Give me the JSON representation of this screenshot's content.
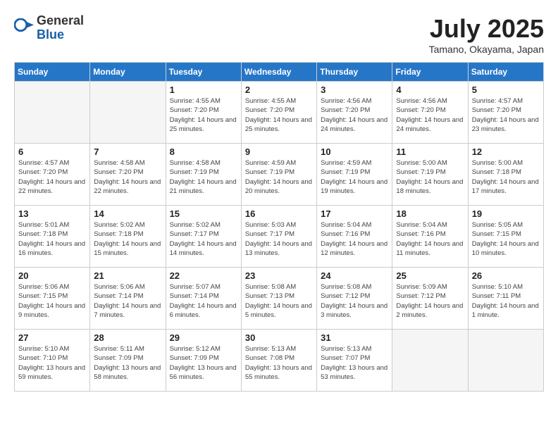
{
  "header": {
    "logo_general": "General",
    "logo_blue": "Blue",
    "month": "July 2025",
    "location": "Tamano, Okayama, Japan"
  },
  "days_of_week": [
    "Sunday",
    "Monday",
    "Tuesday",
    "Wednesday",
    "Thursday",
    "Friday",
    "Saturday"
  ],
  "weeks": [
    [
      {
        "day": "",
        "info": ""
      },
      {
        "day": "",
        "info": ""
      },
      {
        "day": "1",
        "info": "Sunrise: 4:55 AM\nSunset: 7:20 PM\nDaylight: 14 hours and 25 minutes."
      },
      {
        "day": "2",
        "info": "Sunrise: 4:55 AM\nSunset: 7:20 PM\nDaylight: 14 hours and 25 minutes."
      },
      {
        "day": "3",
        "info": "Sunrise: 4:56 AM\nSunset: 7:20 PM\nDaylight: 14 hours and 24 minutes."
      },
      {
        "day": "4",
        "info": "Sunrise: 4:56 AM\nSunset: 7:20 PM\nDaylight: 14 hours and 24 minutes."
      },
      {
        "day": "5",
        "info": "Sunrise: 4:57 AM\nSunset: 7:20 PM\nDaylight: 14 hours and 23 minutes."
      }
    ],
    [
      {
        "day": "6",
        "info": "Sunrise: 4:57 AM\nSunset: 7:20 PM\nDaylight: 14 hours and 22 minutes."
      },
      {
        "day": "7",
        "info": "Sunrise: 4:58 AM\nSunset: 7:20 PM\nDaylight: 14 hours and 22 minutes."
      },
      {
        "day": "8",
        "info": "Sunrise: 4:58 AM\nSunset: 7:19 PM\nDaylight: 14 hours and 21 minutes."
      },
      {
        "day": "9",
        "info": "Sunrise: 4:59 AM\nSunset: 7:19 PM\nDaylight: 14 hours and 20 minutes."
      },
      {
        "day": "10",
        "info": "Sunrise: 4:59 AM\nSunset: 7:19 PM\nDaylight: 14 hours and 19 minutes."
      },
      {
        "day": "11",
        "info": "Sunrise: 5:00 AM\nSunset: 7:19 PM\nDaylight: 14 hours and 18 minutes."
      },
      {
        "day": "12",
        "info": "Sunrise: 5:00 AM\nSunset: 7:18 PM\nDaylight: 14 hours and 17 minutes."
      }
    ],
    [
      {
        "day": "13",
        "info": "Sunrise: 5:01 AM\nSunset: 7:18 PM\nDaylight: 14 hours and 16 minutes."
      },
      {
        "day": "14",
        "info": "Sunrise: 5:02 AM\nSunset: 7:18 PM\nDaylight: 14 hours and 15 minutes."
      },
      {
        "day": "15",
        "info": "Sunrise: 5:02 AM\nSunset: 7:17 PM\nDaylight: 14 hours and 14 minutes."
      },
      {
        "day": "16",
        "info": "Sunrise: 5:03 AM\nSunset: 7:17 PM\nDaylight: 14 hours and 13 minutes."
      },
      {
        "day": "17",
        "info": "Sunrise: 5:04 AM\nSunset: 7:16 PM\nDaylight: 14 hours and 12 minutes."
      },
      {
        "day": "18",
        "info": "Sunrise: 5:04 AM\nSunset: 7:16 PM\nDaylight: 14 hours and 11 minutes."
      },
      {
        "day": "19",
        "info": "Sunrise: 5:05 AM\nSunset: 7:15 PM\nDaylight: 14 hours and 10 minutes."
      }
    ],
    [
      {
        "day": "20",
        "info": "Sunrise: 5:06 AM\nSunset: 7:15 PM\nDaylight: 14 hours and 9 minutes."
      },
      {
        "day": "21",
        "info": "Sunrise: 5:06 AM\nSunset: 7:14 PM\nDaylight: 14 hours and 7 minutes."
      },
      {
        "day": "22",
        "info": "Sunrise: 5:07 AM\nSunset: 7:14 PM\nDaylight: 14 hours and 6 minutes."
      },
      {
        "day": "23",
        "info": "Sunrise: 5:08 AM\nSunset: 7:13 PM\nDaylight: 14 hours and 5 minutes."
      },
      {
        "day": "24",
        "info": "Sunrise: 5:08 AM\nSunset: 7:12 PM\nDaylight: 14 hours and 3 minutes."
      },
      {
        "day": "25",
        "info": "Sunrise: 5:09 AM\nSunset: 7:12 PM\nDaylight: 14 hours and 2 minutes."
      },
      {
        "day": "26",
        "info": "Sunrise: 5:10 AM\nSunset: 7:11 PM\nDaylight: 14 hours and 1 minute."
      }
    ],
    [
      {
        "day": "27",
        "info": "Sunrise: 5:10 AM\nSunset: 7:10 PM\nDaylight: 13 hours and 59 minutes."
      },
      {
        "day": "28",
        "info": "Sunrise: 5:11 AM\nSunset: 7:09 PM\nDaylight: 13 hours and 58 minutes."
      },
      {
        "day": "29",
        "info": "Sunrise: 5:12 AM\nSunset: 7:09 PM\nDaylight: 13 hours and 56 minutes."
      },
      {
        "day": "30",
        "info": "Sunrise: 5:13 AM\nSunset: 7:08 PM\nDaylight: 13 hours and 55 minutes."
      },
      {
        "day": "31",
        "info": "Sunrise: 5:13 AM\nSunset: 7:07 PM\nDaylight: 13 hours and 53 minutes."
      },
      {
        "day": "",
        "info": ""
      },
      {
        "day": "",
        "info": ""
      }
    ]
  ]
}
